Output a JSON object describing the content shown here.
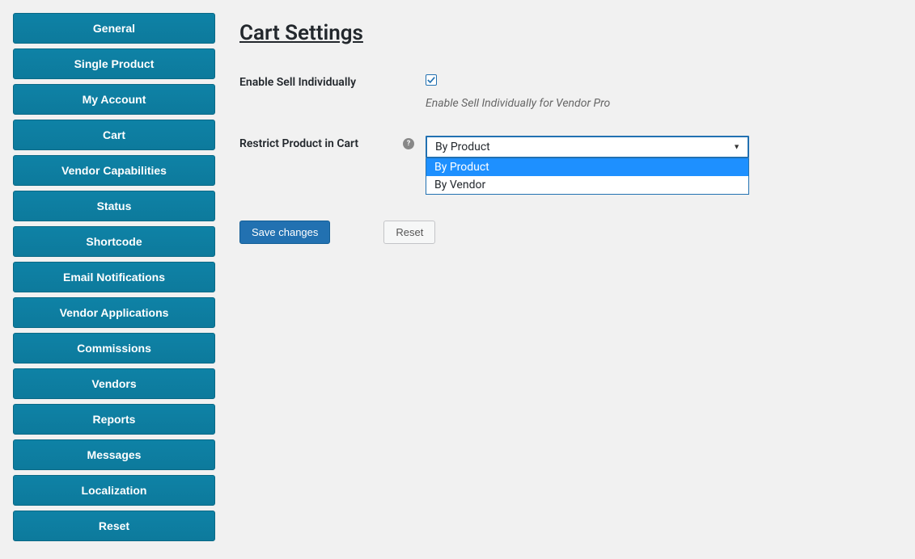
{
  "sidebar": {
    "items": [
      {
        "label": "General"
      },
      {
        "label": "Single Product"
      },
      {
        "label": "My Account"
      },
      {
        "label": "Cart"
      },
      {
        "label": "Vendor Capabilities"
      },
      {
        "label": "Status"
      },
      {
        "label": "Shortcode"
      },
      {
        "label": "Email Notifications"
      },
      {
        "label": "Vendor Applications"
      },
      {
        "label": "Commissions"
      },
      {
        "label": "Vendors"
      },
      {
        "label": "Reports"
      },
      {
        "label": "Messages"
      },
      {
        "label": "Localization"
      },
      {
        "label": "Reset"
      }
    ]
  },
  "page": {
    "title": "Cart Settings"
  },
  "fields": {
    "enable_sell_individually": {
      "label": "Enable Sell Individually",
      "checked": true,
      "description": "Enable Sell Individually for Vendor Pro"
    },
    "restrict_product": {
      "label": "Restrict Product in Cart",
      "selected": "By Product",
      "options": [
        {
          "label": "By Product",
          "highlighted": true
        },
        {
          "label": "By Vendor",
          "highlighted": false
        }
      ]
    }
  },
  "actions": {
    "save": "Save changes",
    "reset": "Reset"
  }
}
